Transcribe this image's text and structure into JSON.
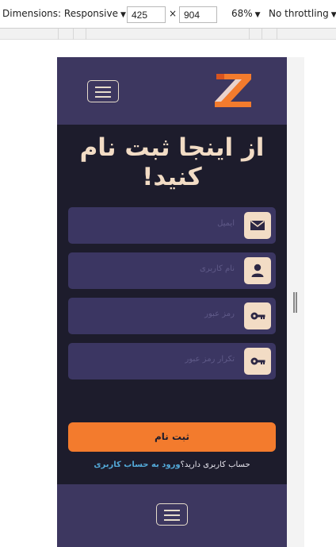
{
  "devtools": {
    "dimensions_label": "Dimensions: Responsive",
    "width": "425",
    "times": "×",
    "height": "904",
    "zoom": "68%",
    "throttling": "No throttling"
  },
  "page": {
    "title_line1": "از اینجا ثبت نام",
    "title_line2": "کنید!",
    "fields": [
      {
        "placeholder": "ایمیل",
        "icon": "envelope-icon"
      },
      {
        "placeholder": "نام کاربری",
        "icon": "user-icon"
      },
      {
        "placeholder": "رمز عبور",
        "icon": "key-icon"
      },
      {
        "placeholder": "تکرار رمز عبور",
        "icon": "key-icon"
      }
    ],
    "submit_label": "ثبت نام",
    "login_prompt": "حساب کاربری دارید؟",
    "login_link": "ورود به حساب کاربری"
  },
  "colors": {
    "header_bg": "#3d3760",
    "page_bg": "#1d1c2c",
    "accent": "#f37b2d",
    "title": "#f2dcc5",
    "link": "#53a9d8"
  }
}
